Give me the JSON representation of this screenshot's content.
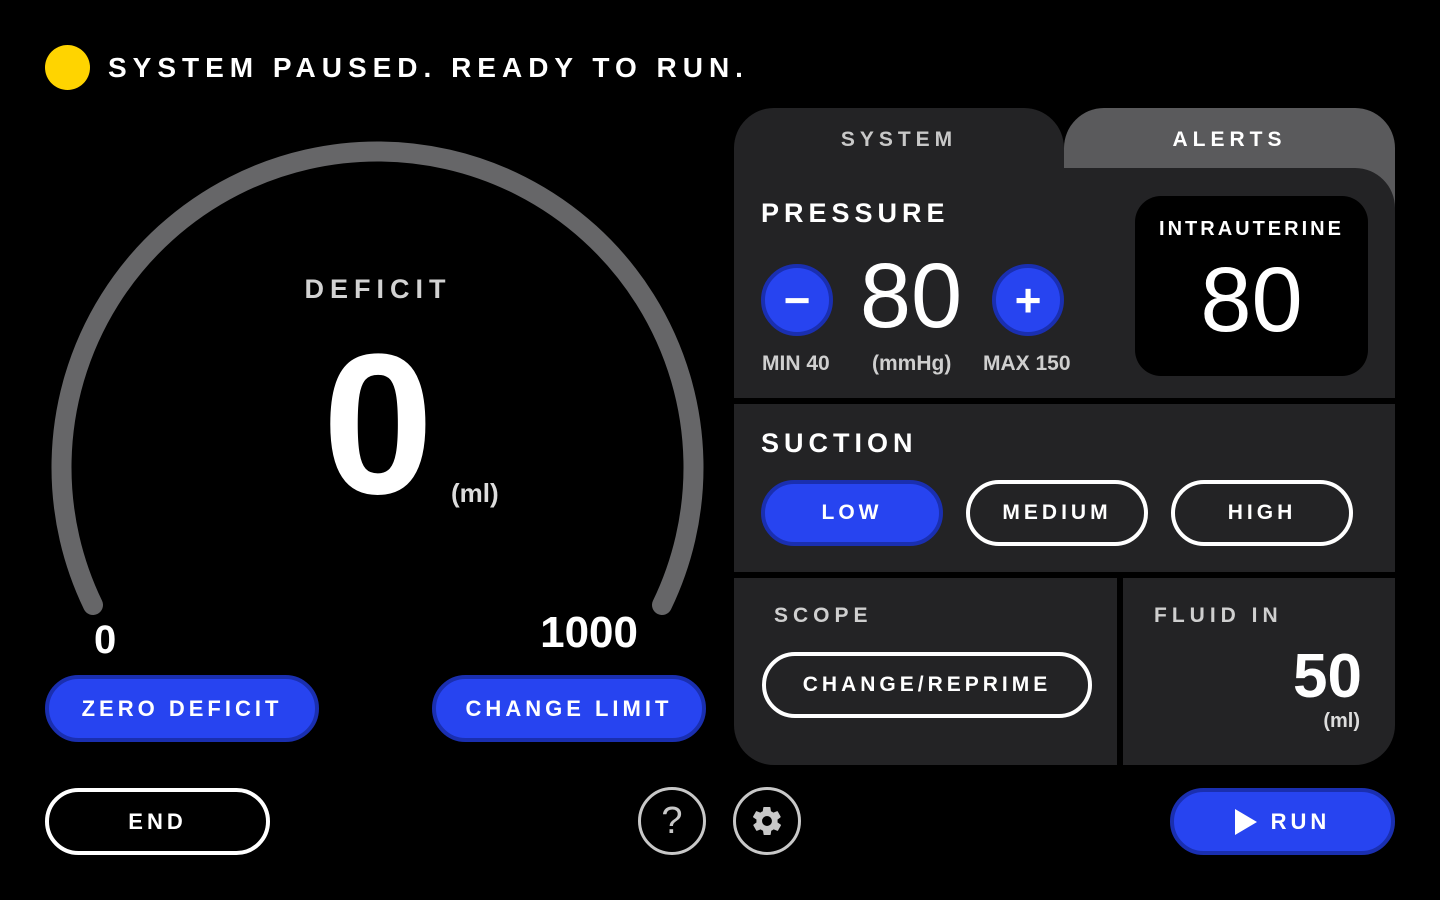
{
  "status": {
    "text": "SYSTEM PAUSED. READY TO RUN.",
    "color": "#ffd400"
  },
  "deficit": {
    "label": "DEFICIT",
    "value": "0",
    "unit": "(ml)",
    "scale_min": "0",
    "scale_max": "1000",
    "zero_label": "ZERO DEFICIT",
    "change_limit_label": "CHANGE LIMIT"
  },
  "tabs": {
    "system": "SYSTEM",
    "alerts": "ALERTS"
  },
  "pressure": {
    "title": "PRESSURE",
    "value": "80",
    "unit": "(mmHg)",
    "min_label": "MIN 40",
    "max_label": "MAX 150",
    "intrauterine_label": "INTRAUTERINE",
    "intrauterine_value": "80"
  },
  "suction": {
    "title": "SUCTION",
    "options": [
      "LOW",
      "MEDIUM",
      "HIGH"
    ],
    "selected": "LOW"
  },
  "scope": {
    "title": "SCOPE",
    "button": "CHANGE/REPRIME"
  },
  "fluid_in": {
    "title": "FLUID IN",
    "value": "50",
    "unit": "(ml)"
  },
  "controls": {
    "end": "END",
    "run": "RUN",
    "help_symbol": "?"
  },
  "colors": {
    "accent": "#2744f0",
    "panel": "#232325",
    "alerts_tab": "#5a5a5c"
  }
}
